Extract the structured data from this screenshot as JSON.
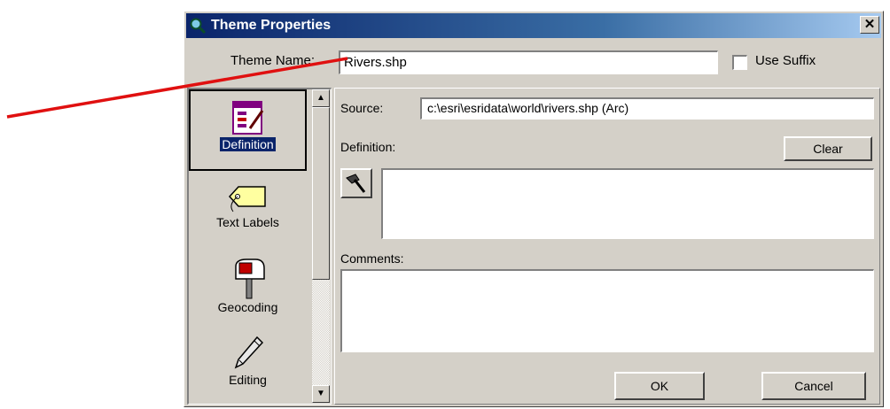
{
  "window": {
    "title": "Theme Properties",
    "close_glyph": "✕"
  },
  "theme_name": {
    "label": "Theme Name:",
    "value": "Rivers.shp"
  },
  "use_suffix": {
    "label": "Use Suffix",
    "checked": false
  },
  "sidebar": {
    "items": [
      {
        "label": "Definition",
        "icon": "definition-icon",
        "selected": true
      },
      {
        "label": "Text Labels",
        "icon": "tag-icon",
        "selected": false
      },
      {
        "label": "Geocoding",
        "icon": "mailbox-icon",
        "selected": false
      },
      {
        "label": "Editing",
        "icon": "pencil-icon",
        "selected": false
      }
    ]
  },
  "panel": {
    "source_label": "Source:",
    "source_value": "c:\\esri\\esridata\\world\\rivers.shp (Arc)",
    "definition_label": "Definition:",
    "clear_label": "Clear",
    "comments_label": "Comments:",
    "ok_label": "OK",
    "cancel_label": "Cancel"
  },
  "colors": {
    "titlebar_start": "#0a246a",
    "titlebar_end": "#a6caf0",
    "dialog_face": "#d4d0c8",
    "annotation_arrow": "#e01010"
  }
}
